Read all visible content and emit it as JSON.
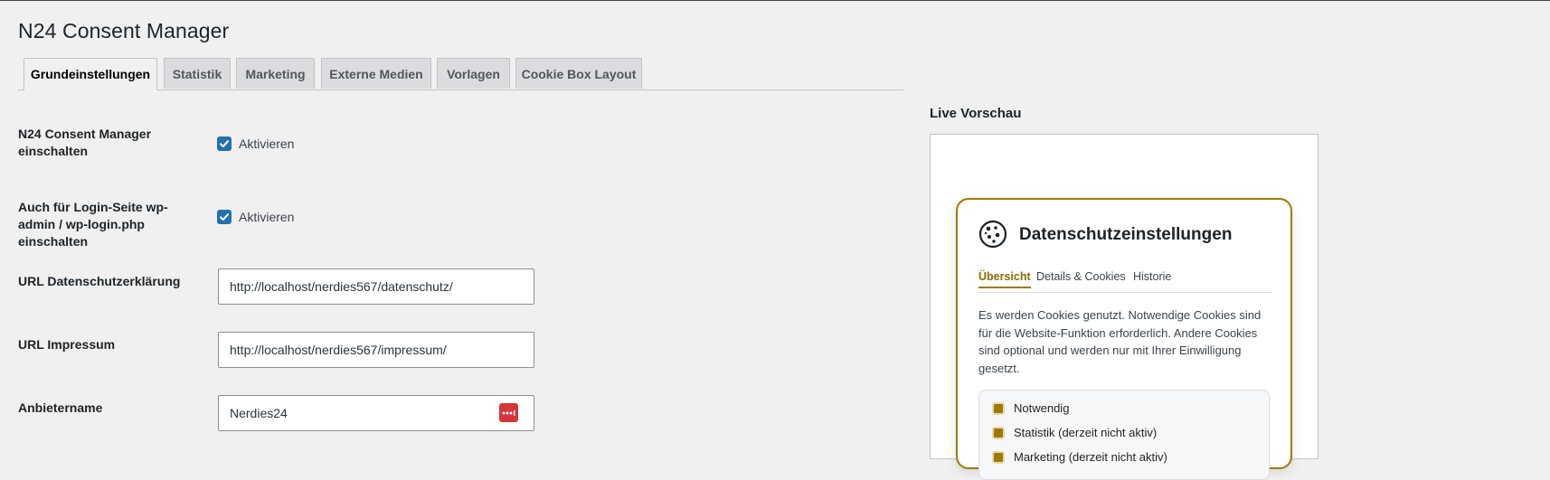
{
  "page": {
    "title": "N24 Consent Manager"
  },
  "tabs": [
    {
      "label": "Grundeinstellungen"
    },
    {
      "label": "Statistik"
    },
    {
      "label": "Marketing"
    },
    {
      "label": "Externe Medien"
    },
    {
      "label": "Vorlagen"
    },
    {
      "label": "Cookie Box Layout"
    }
  ],
  "settings": {
    "enable": {
      "label": "N24 Consent Manager einschalten",
      "checkbox_label": "Aktivieren",
      "checked": true
    },
    "login": {
      "label": "Auch für Login-Seite wp-admin / wp-login.php einschalten",
      "checkbox_label": "Aktivieren",
      "checked": true
    },
    "privacy_url": {
      "label": "URL Datenschutzerklärung",
      "value": "http://localhost/nerdies567/datenschutz/"
    },
    "imprint_url": {
      "label": "URL Impressum",
      "value": "http://localhost/nerdies567/impressum/"
    },
    "provider": {
      "label": "Anbietername",
      "value": "Nerdies24"
    }
  },
  "preview": {
    "heading": "Live Vorschau",
    "box": {
      "title": "Datenschutzeinstellungen",
      "tabs": [
        {
          "label": "Übersicht"
        },
        {
          "label": "Details & Cookies"
        },
        {
          "label": "Historie"
        }
      ],
      "text": "Es werden Cookies genutzt. Notwendige Cookies sind für die Website-Funktion erforderlich. Andere Cookies sind optional und werden nur mit Ihrer Einwilligung gesetzt.",
      "items": [
        {
          "label": "Notwendig"
        },
        {
          "label": "Statistik (derzeit nicht aktiv)"
        },
        {
          "label": "Marketing (derzeit nicht aktiv)"
        }
      ]
    }
  },
  "colors": {
    "accent": "#2271b1",
    "cookie_accent": "#a07a00",
    "password_icon": "#d63638",
    "background": "#f0f0f1"
  }
}
